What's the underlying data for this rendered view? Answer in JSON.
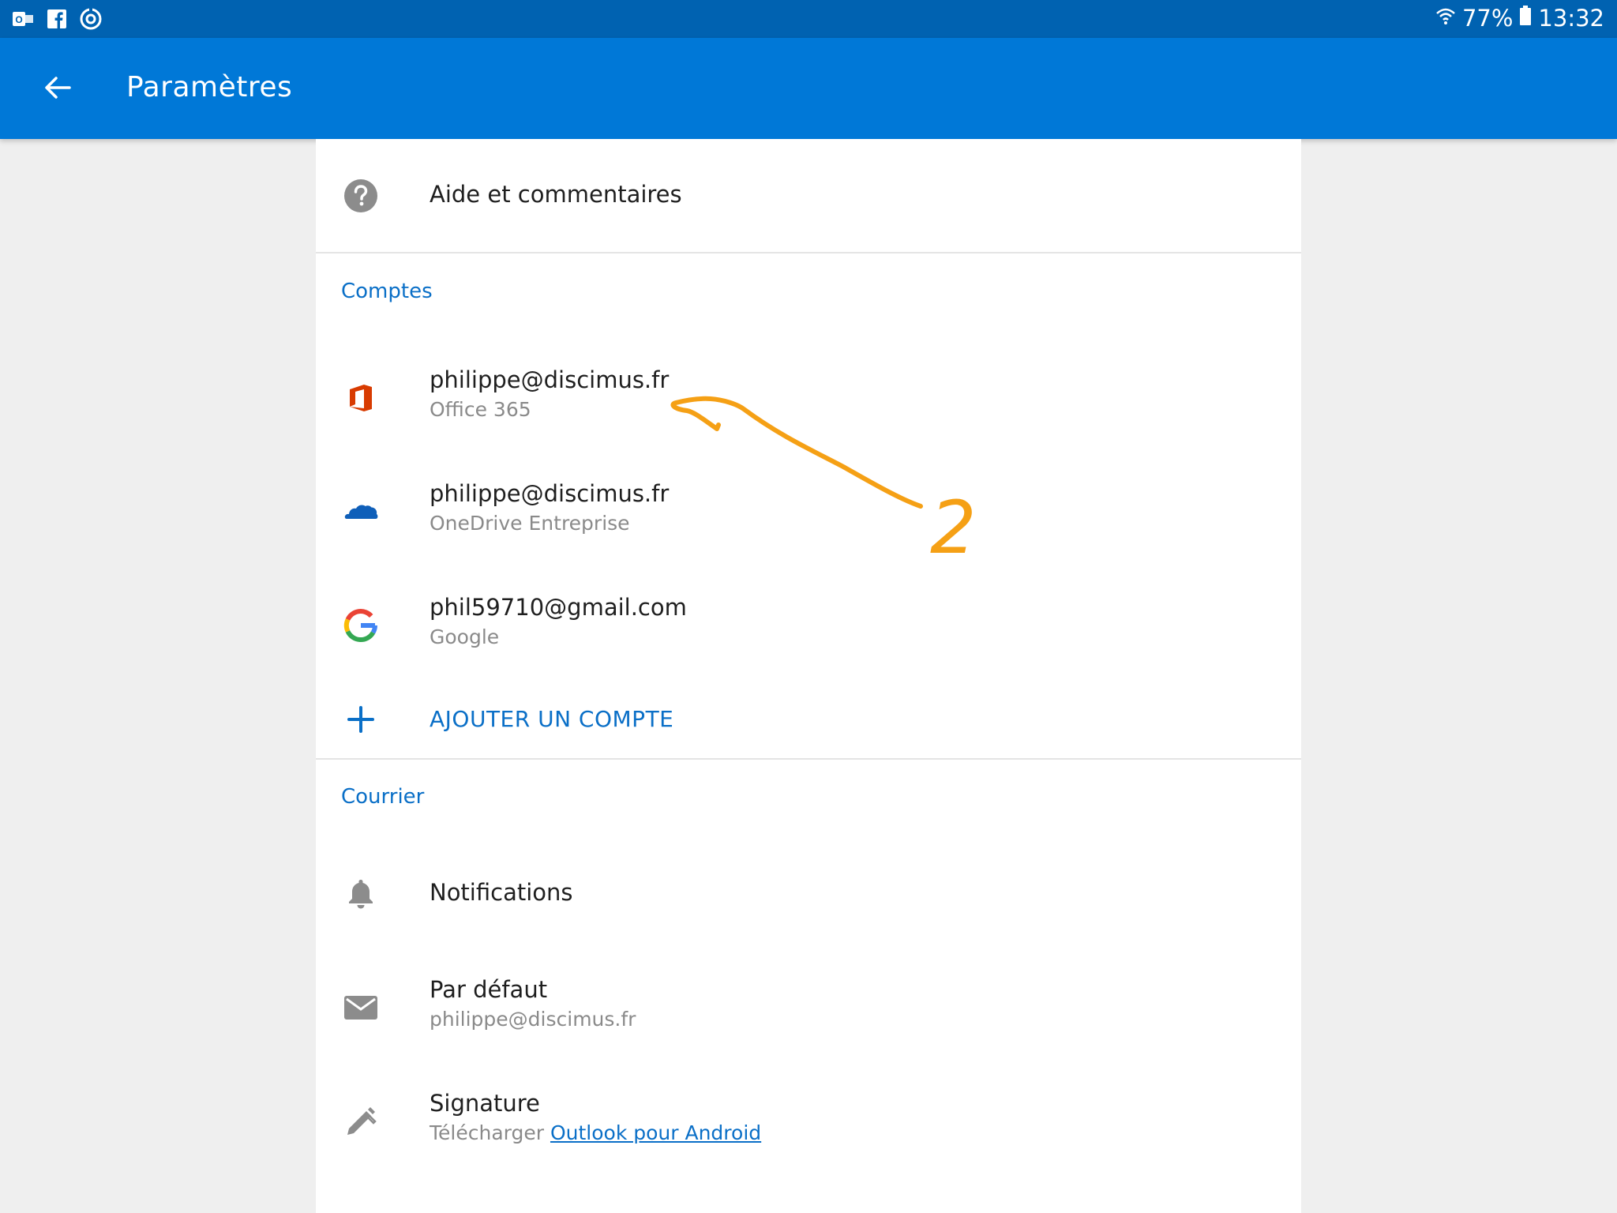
{
  "status_bar": {
    "icons": [
      "outlook-icon",
      "facebook-icon",
      "sync-icon",
      "wifi-icon",
      "battery-icon"
    ],
    "battery": "77%",
    "time": "13:32"
  },
  "app_bar": {
    "title": "Paramètres",
    "back_icon": "arrow-left-icon",
    "color": "#0078d7"
  },
  "help": {
    "label": "Aide et commentaires",
    "icon": "help-circle-icon"
  },
  "accounts": {
    "header": "Comptes",
    "items": [
      {
        "email": "philippe@discimus.fr",
        "type": "Office 365",
        "icon": "office-icon"
      },
      {
        "email": "philippe@discimus.fr",
        "type": "OneDrive Entreprise",
        "icon": "onedrive-icon"
      },
      {
        "email": "phil59710@gmail.com",
        "type": "Google",
        "icon": "google-icon"
      }
    ],
    "add_label": "AJOUTER UN COMPTE",
    "add_icon": "plus-icon"
  },
  "mail": {
    "header": "Courrier",
    "notifications": {
      "label": "Notifications",
      "icon": "bell-icon"
    },
    "default": {
      "label": "Par défaut",
      "value": "philippe@discimus.fr",
      "icon": "envelope-icon"
    },
    "signature": {
      "label": "Signature",
      "prefix": "Télécharger",
      "link": "Outlook pour Android",
      "icon": "pen-icon"
    }
  },
  "annotation": {
    "text": "2",
    "color": "#f5a015"
  },
  "colors": {
    "accent": "#0a6fc7",
    "status_bar": "#0062b1",
    "office_red": "#d83b01",
    "onedrive_blue": "#0f5fb9"
  }
}
